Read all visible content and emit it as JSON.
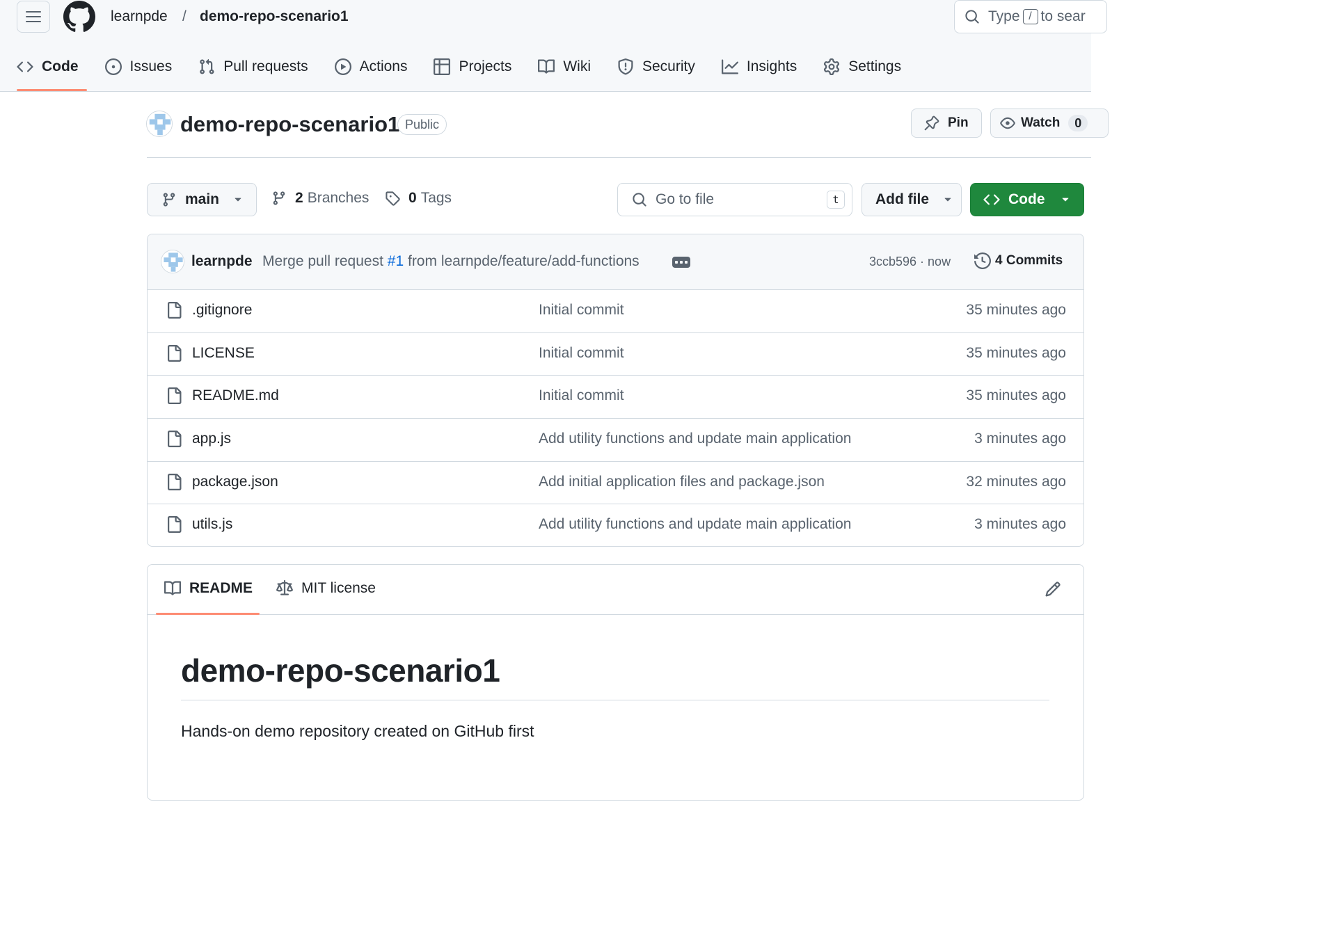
{
  "header": {
    "owner": "learnpde",
    "separator": "/",
    "repo": "demo-repo-scenario1",
    "search": {
      "prefix": "Type",
      "key": "/",
      "suffix": "to sear"
    }
  },
  "nav": [
    {
      "label": "Code",
      "icon": "code-icon",
      "active": true
    },
    {
      "label": "Issues",
      "icon": "issue-opened-icon"
    },
    {
      "label": "Pull requests",
      "icon": "git-pull-request-icon"
    },
    {
      "label": "Actions",
      "icon": "play-icon"
    },
    {
      "label": "Projects",
      "icon": "table-icon"
    },
    {
      "label": "Wiki",
      "icon": "book-icon"
    },
    {
      "label": "Security",
      "icon": "shield-icon"
    },
    {
      "label": "Insights",
      "icon": "graph-icon"
    },
    {
      "label": "Settings",
      "icon": "gear-icon"
    }
  ],
  "repo": {
    "title": "demo-repo-scenario1",
    "visibility": "Public",
    "pin_label": "Pin",
    "watch_label": "Watch",
    "watch_count": "0"
  },
  "toolbar": {
    "branch": "main",
    "branches_count": "2",
    "branches_label": "Branches",
    "tags_count": "0",
    "tags_label": "Tags",
    "goto_placeholder": "Go to file",
    "goto_key": "t",
    "add_file_label": "Add file",
    "code_label": "Code"
  },
  "latest_commit": {
    "author": "learnpde",
    "message_prefix": "Merge pull request",
    "pr_ref": "#1",
    "message_suffix": "from learnpde/feature/add-functions",
    "sha_time": "3ccb596 · now",
    "commits_label": "4 Commits"
  },
  "files": [
    {
      "name": ".gitignore",
      "message": "Initial commit",
      "time": "35 minutes ago"
    },
    {
      "name": "LICENSE",
      "message": "Initial commit",
      "time": "35 minutes ago"
    },
    {
      "name": "README.md",
      "message": "Initial commit",
      "time": "35 minutes ago"
    },
    {
      "name": "app.js",
      "message": "Add utility functions and update main application",
      "time": "3 minutes ago"
    },
    {
      "name": "package.json",
      "message": "Add initial application files and package.json",
      "time": "32 minutes ago"
    },
    {
      "name": "utils.js",
      "message": "Add utility functions and update main application",
      "time": "3 minutes ago"
    }
  ],
  "readme": {
    "tab_readme": "README",
    "tab_license": "MIT license",
    "heading": "demo-repo-scenario1",
    "description": "Hands-on demo repository created on GitHub first"
  },
  "colors": {
    "accent_underline": "#fd8c73",
    "primary_button": "#1f883d",
    "link": "#0969da",
    "muted_text": "#59636e",
    "border": "#d1d9e0"
  }
}
